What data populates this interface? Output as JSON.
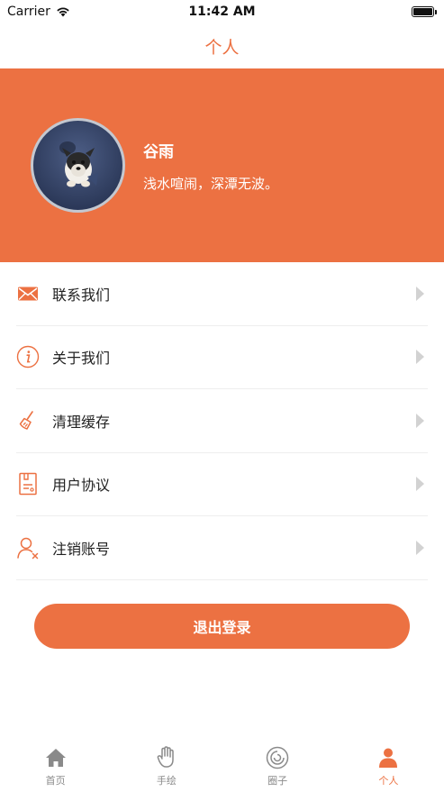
{
  "status_bar": {
    "carrier": "Carrier",
    "time": "11:42 AM"
  },
  "nav": {
    "title": "个人"
  },
  "profile": {
    "name": "谷雨",
    "motto": "浅水喧闹，深潭无波。"
  },
  "menu": {
    "items": [
      {
        "label": "联系我们",
        "icon": "mail-icon"
      },
      {
        "label": "关于我们",
        "icon": "info-icon"
      },
      {
        "label": "清理缓存",
        "icon": "broom-icon"
      },
      {
        "label": "用户协议",
        "icon": "document-icon"
      },
      {
        "label": "注销账号",
        "icon": "user-remove-icon"
      }
    ]
  },
  "logout": {
    "label": "退出登录"
  },
  "tabs": [
    {
      "label": "首页",
      "icon": "home-icon",
      "active": false
    },
    {
      "label": "手绘",
      "icon": "hand-icon",
      "active": false
    },
    {
      "label": "圈子",
      "icon": "circle-icon",
      "active": false
    },
    {
      "label": "个人",
      "icon": "person-icon",
      "active": true
    }
  ],
  "colors": {
    "accent": "#ec7142",
    "inactive": "#8a8a8a",
    "divider": "#eeeeee"
  }
}
